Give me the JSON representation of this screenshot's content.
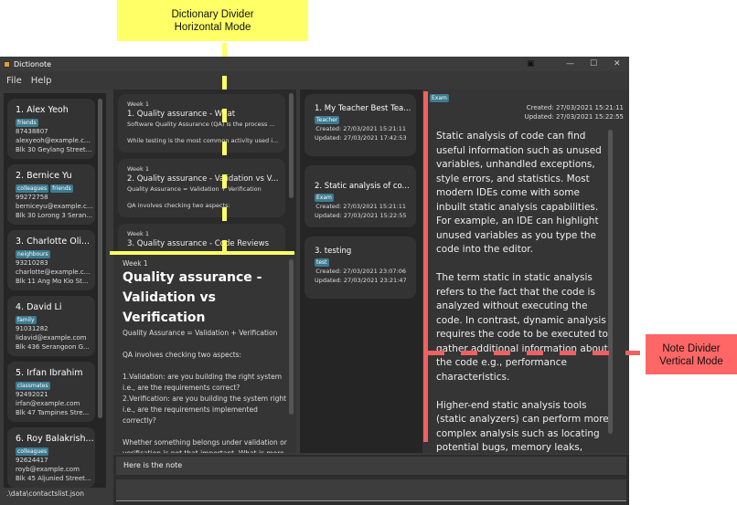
{
  "window": {
    "title": "Dictionote"
  },
  "menu": [
    "File",
    "Help"
  ],
  "contacts": [
    {
      "name": "1.  Alex Yeoh",
      "tags": [
        "friends"
      ],
      "phone": "87438807",
      "email": "alexyeoh@example.c...",
      "address": "Blk 30 Geylang Street..."
    },
    {
      "name": "2.  Bernice Yu",
      "tags": [
        "colleagues",
        "friends"
      ],
      "phone": "99272758",
      "email": "berniceyu@example.c...",
      "address": "Blk 30 Lorong 3 Seran..."
    },
    {
      "name": "3.  Charlotte Oli...",
      "tags": [
        "neighbours"
      ],
      "phone": "93210283",
      "email": "charlotte@example.c...",
      "address": "Blk 11 Ang Mo Kio St..."
    },
    {
      "name": "4.  David Li",
      "tags": [
        "family"
      ],
      "phone": "91031282",
      "email": "lidavid@example.com",
      "address": "Blk 436 Serangoon G..."
    },
    {
      "name": "5.  Irfan Ibrahim",
      "tags": [
        "classmates"
      ],
      "phone": "92492021",
      "email": "irfan@example.com",
      "address": "Blk 47 Tampines Stre..."
    },
    {
      "name": "6.  Roy Balakrish...",
      "tags": [
        "colleagues"
      ],
      "phone": "92624417",
      "email": "royb@example.com",
      "address": "Blk 45 Aljunied Street..."
    }
  ],
  "status_path": ".\\data\\contactslist.json",
  "dictionary": [
    {
      "week": "Week 1",
      "title": "1.  Quality assurance - What",
      "line1": "Software Quality Assurance (QA) is the process ...",
      "line2": "While testing is the most common activity used i..."
    },
    {
      "week": "Week 1",
      "title": "2.  Quality assurance - Validation vs V...",
      "line1": "Quality Assurance = Validation + Verification",
      "line2": "QA involves checking two aspects:"
    },
    {
      "week": "Week 1",
      "title": "3.  Quality assurance - Code Reviews",
      "line1": "",
      "line2": ""
    }
  ],
  "dict_detail": {
    "week": "Week 1",
    "title": "Quality assurance - Validation vs Verification",
    "body": "Quality Assurance = Validation + Verification\n\nQA involves checking two aspects:\n\n1.Validation: are you building the right system i.e., are the requirements correct?\n2.Verification: are you building the system right i.e., are the requirements implemented correctly?\n\nWhether something belongs under validation or verification is not that important. What is more important is that both are done, instead"
  },
  "notes": [
    {
      "title": "1.  My Teacher Best Tea...",
      "tag": "Teacher",
      "created": "Created: 27/03/2021 15:21:11",
      "updated": "Updated: 27/03/2021 17:42:53"
    },
    {
      "title": "2.  Static analysis of co...",
      "tag": "Exam",
      "created": "Created: 27/03/2021 15:21:11",
      "updated": "Updated: 27/03/2021 15:22:55"
    },
    {
      "title": "3.  testing",
      "tag": "test",
      "created": "Created: 27/03/2021 23:07:06",
      "updated": "Updated: 27/03/2021 23:21:47"
    }
  ],
  "note_detail": {
    "tag": "Exam",
    "created": "Created: 27/03/2021 15:21:11",
    "updated": "Updated: 27/03/2021 15:22:55",
    "body": "Static analysis of code can find useful information such as unused variables, unhandled exceptions, style errors, and statistics. Most modern IDEs come with some inbuilt static analysis capabilities. For example, an IDE can highlight unused variables as you type the code into the editor.\n\nThe term static in static analysis refers to the fact that the code is analyzed without executing the code. In contrast, dynamic analysis requires the code to be executed to gather additional information about the code e.g., performance characteristics.\n\nHigher-end static analysis tools (static analyzers) can perform more complex analysis such as locating potential bugs, memory leaks, inefficient code structures, etc."
  },
  "result_text": "Here is the note",
  "command_input": {
    "value": ""
  },
  "annotations": {
    "dictionary_divider": "Dictionary Divider\nHorizontal Mode",
    "note_divider": "Note Divider\nVertical Mode",
    "yellow": "#ffff66",
    "red": "#ff6666"
  }
}
